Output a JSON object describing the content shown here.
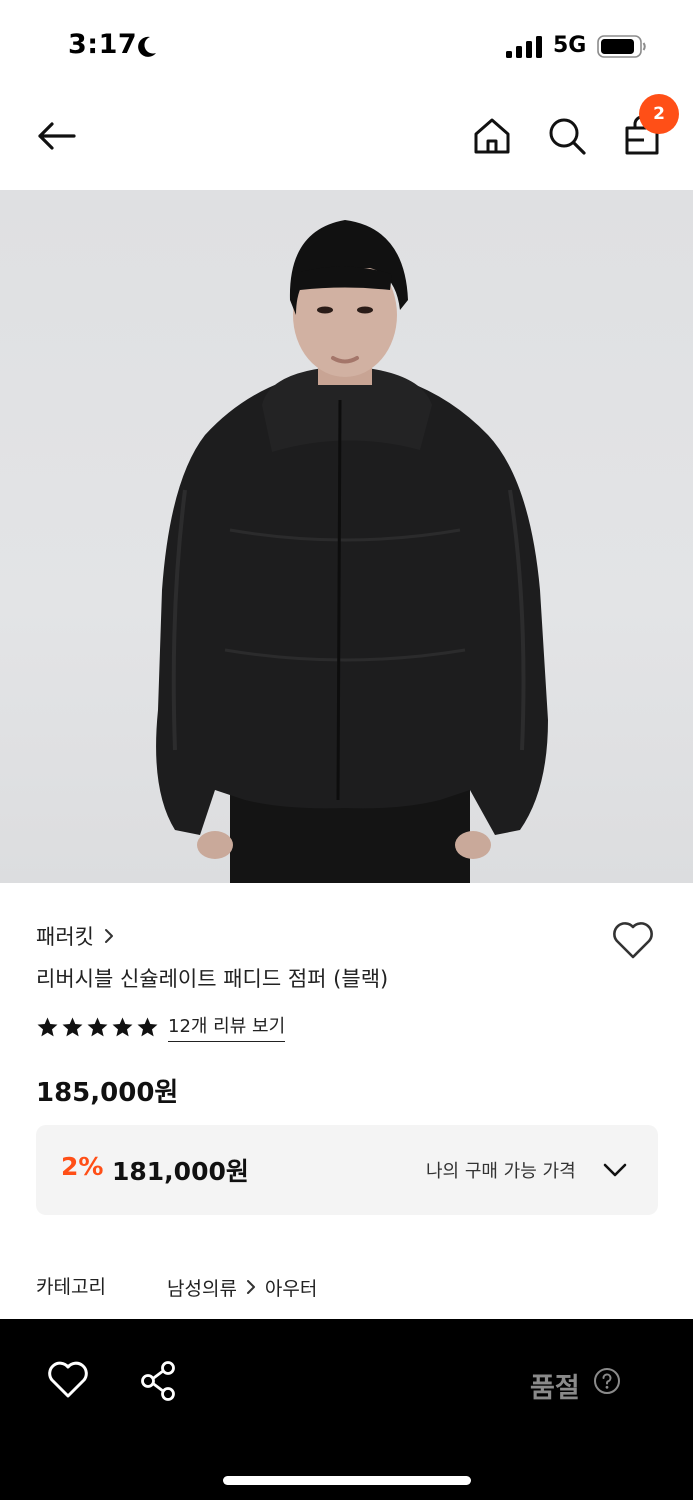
{
  "status_bar": {
    "time": "3:17",
    "network": "5G"
  },
  "header": {
    "icons": [
      "back-arrow-icon",
      "home-icon",
      "search-icon",
      "shopping-bag-icon"
    ],
    "cart_count": "2"
  },
  "product": {
    "image": "model wearing black hooded padded jacket",
    "brand": "패러킷",
    "title": "리버시블 신슐레이트 패디드 점퍼 (블랙)",
    "rating_stars": 5,
    "review_link": "12개 리뷰 보기",
    "price": "185,000원",
    "discount": {
      "rate": "2%",
      "price": "181,000원",
      "label": "나의 구매 가능 가격"
    },
    "category_label": "카테고리",
    "category_path": [
      "남성의류",
      "아우터"
    ]
  },
  "bottom_bar": {
    "icons": [
      "heart-icon",
      "share-icon",
      "help-circle-icon"
    ],
    "soldout_label": "품절"
  },
  "colors": {
    "accent": "#ff4f17",
    "bottom_bar": "#000000",
    "soldout_text": "#8a8a8a"
  }
}
